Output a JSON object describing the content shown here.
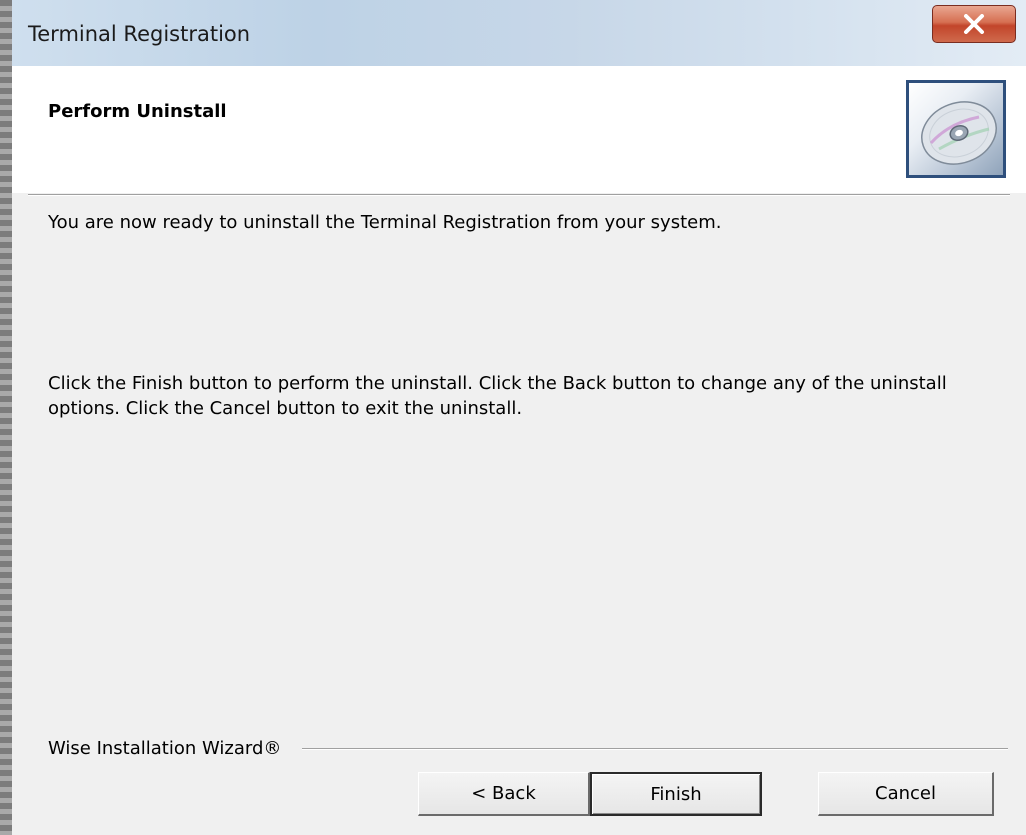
{
  "window": {
    "title": "Terminal Registration"
  },
  "header": {
    "title": "Perform Uninstall",
    "icon": "cd-disc-icon"
  },
  "body": {
    "ready_text": "You are now ready to uninstall the Terminal Registration from your system.",
    "instructions_line1": "Click the Finish button to perform the uninstall. Click the Back button to change any of the uninstall",
    "instructions_line2": "options. Click the Cancel button to exit the uninstall."
  },
  "footer": {
    "brand": "Wise Installation Wizard®"
  },
  "buttons": {
    "back": "< Back",
    "finish": "Finish",
    "cancel": "Cancel"
  },
  "colors": {
    "close_button": "#c9452c",
    "dialog_bg": "#f0f0f0",
    "header_bg": "#ffffff"
  }
}
